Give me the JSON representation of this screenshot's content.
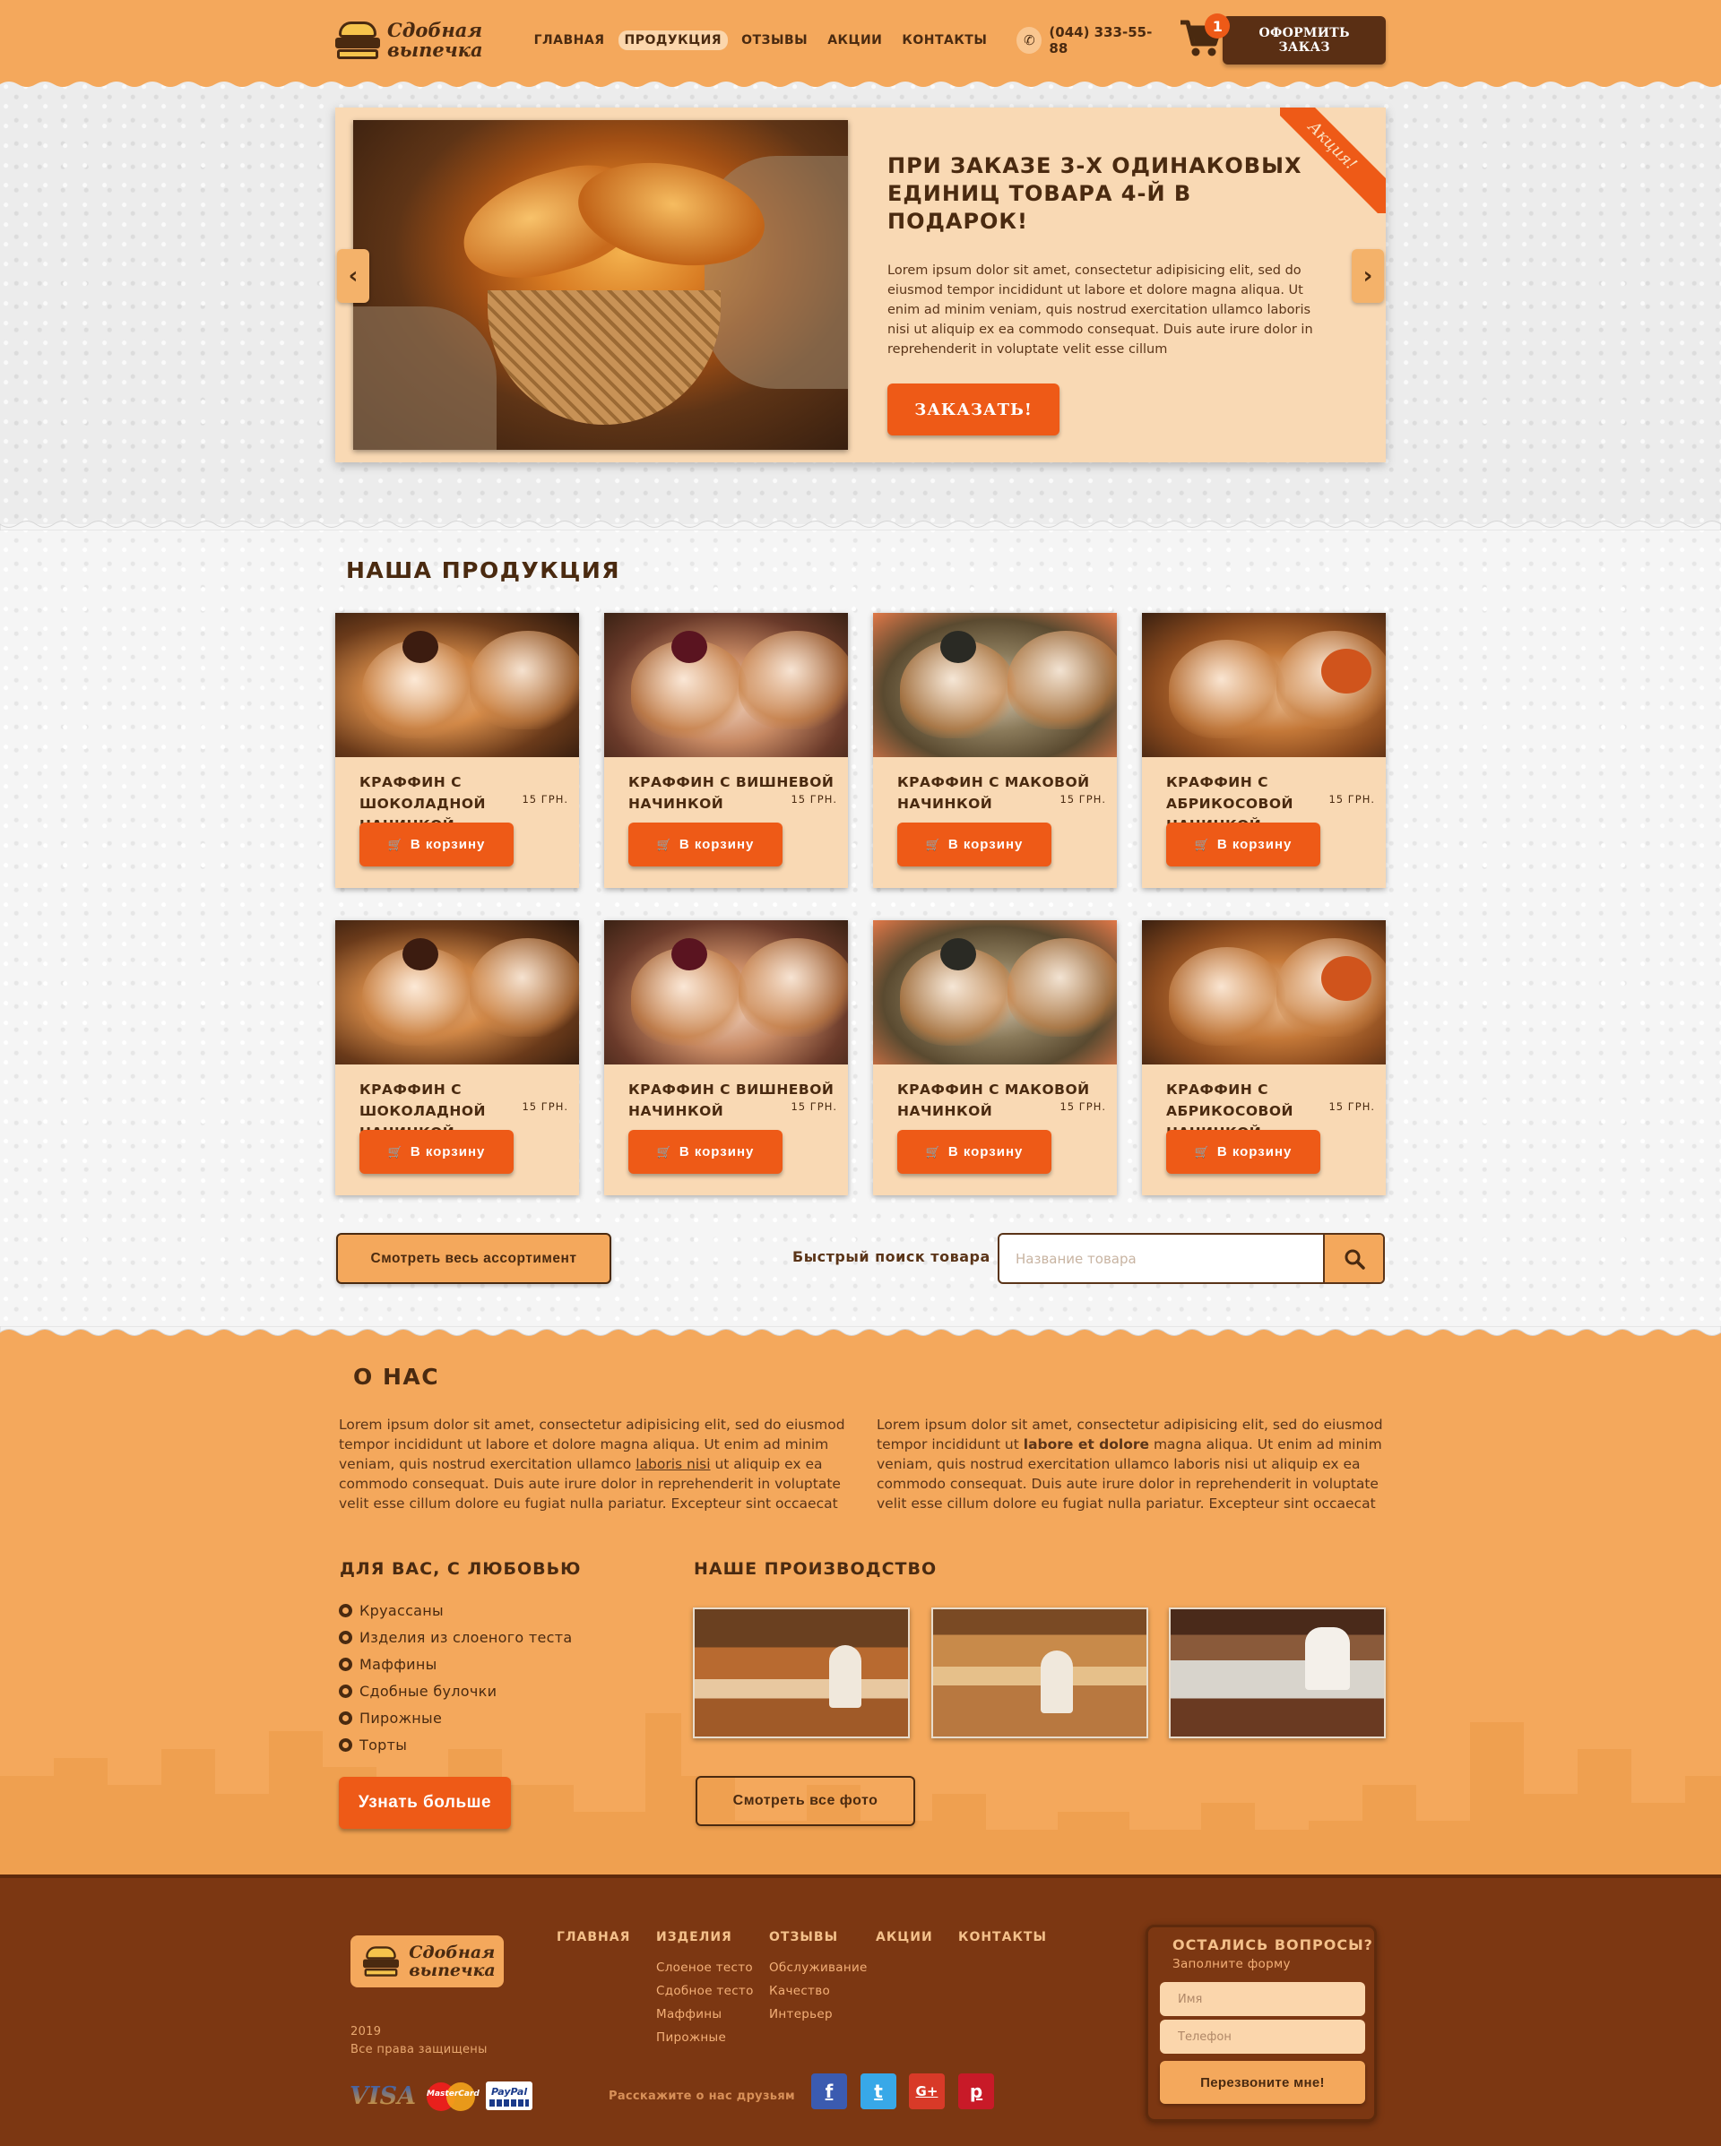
{
  "brand": {
    "line1": "Сдобная",
    "line2": "выпечка"
  },
  "nav": {
    "items": [
      {
        "label": "ГЛАВНАЯ"
      },
      {
        "label": "ПРОДУКЦИЯ",
        "active": true
      },
      {
        "label": "ОТЗЫВЫ"
      },
      {
        "label": "АКЦИИ"
      },
      {
        "label": "КОНТАКТЫ"
      }
    ]
  },
  "header": {
    "phone": "(044) 333-55-88",
    "cart_count": "1",
    "order_button": "ОФОРМИТЬ ЗАКАЗ"
  },
  "hero": {
    "title_line1": "ПРИ ЗАКАЗЕ 3-Х ОДИНАКОВЫХ",
    "title_line2": "ЕДИНИЦ ТОВАРА 4-Й В ПОДАРОК!",
    "text": "Lorem ipsum dolor sit amet, consectetur adipisicing elit, sed do eiusmod tempor incididunt ut labore et dolore magna aliqua. Ut enim ad minim veniam, quis nostrud exercitation ullamco laboris nisi ut aliquip ex ea commodo consequat. Duis aute irure dolor in reprehenderit in voluptate velit esse cillum",
    "button": "ЗАКАЗАТЬ!",
    "ribbon": "Акция!",
    "slides": 3,
    "active_slide": 2
  },
  "products": {
    "title": "НАША ПРОДУКЦИЯ",
    "add_to_cart": "В корзину",
    "items": [
      {
        "name1": "КРАФФИН С ШОКОЛАДНОЙ",
        "name2": "НАЧИНКОЙ",
        "price": "15 ГРН."
      },
      {
        "name1": "КРАФФИН С ВИШНЕВОЙ",
        "name2": "НАЧИНКОЙ",
        "price": "15 ГРН."
      },
      {
        "name1": "КРАФФИН С МАКОВОЙ",
        "name2": "НАЧИНКОЙ",
        "price": "15 ГРН."
      },
      {
        "name1": "КРАФФИН С АБРИКОСОВОЙ",
        "name2": "НАЧИНКОЙ",
        "price": "15 ГРН."
      },
      {
        "name1": "КРАФФИН С ШОКОЛАДНОЙ",
        "name2": "НАЧИНКОЙ",
        "price": "15 ГРН."
      },
      {
        "name1": "КРАФФИН С ВИШНЕВОЙ",
        "name2": "НАЧИНКОЙ",
        "price": "15 ГРН."
      },
      {
        "name1": "КРАФФИН С МАКОВОЙ",
        "name2": "НАЧИНКОЙ",
        "price": "15 ГРН."
      },
      {
        "name1": "КРАФФИН С АБРИКОСОВОЙ",
        "name2": "НАЧИНКОЙ",
        "price": "15 ГРН."
      }
    ],
    "all_button": "Смотреть весь ассортимент",
    "search_label": "Быстрый поиск товара",
    "search_placeholder": "Название товара"
  },
  "about": {
    "title": "О НАС",
    "col1_a": "Lorem ipsum dolor sit amet, consectetur adipisicing elit, sed do eiusmod tempor incididunt ut labore et dolore magna aliqua. Ut enim ad minim veniam, quis nostrud exercitation ullamco ",
    "col1_link": "laboris nisi",
    "col1_b": " ut aliquip ex ea commodo consequat. Duis aute irure dolor in reprehenderit in voluptate velit esse cillum dolore eu fugiat nulla pariatur. Excepteur sint occaecat",
    "col2_a": "Lorem ipsum dolor sit amet, consectetur adipisicing elit, sed do eiusmod tempor incididunt ut ",
    "col2_bold": "labore et dolore",
    "col2_b": " magna aliqua. Ut enim ad minim veniam, quis nostrud exercitation ullamco laboris nisi ut aliquip ex ea commodo consequat. Duis aute irure dolor in reprehenderit in voluptate velit esse cillum dolore eu fugiat nulla pariatur. Excepteur sint occaecat",
    "love_title": "ДЛЯ ВАС, С ЛЮБОВЬЮ",
    "love_items": [
      "Круассаны",
      "Изделия из слоеного теста",
      "Маффины",
      "Сдобные булочки",
      "Пирожные",
      "Торты"
    ],
    "more_button": "Узнать больше",
    "production_title": "НАШЕ ПРОИЗВОДСТВО",
    "photos_button": "Смотреть все фото"
  },
  "footer": {
    "year": "2019",
    "rights": "Все права защищены",
    "nav": {
      "home": "ГЛАВНАЯ",
      "products": "ИЗДЕЛИЯ",
      "products_items": [
        "Слоеное тесто",
        "Сдобное тесто",
        "Маффины",
        "Пирожные"
      ],
      "reviews": "ОТЗЫВЫ",
      "reviews_items": [
        "Обслуживание",
        "Качество",
        "Интерьер"
      ],
      "promos": "АКЦИИ",
      "contacts": "КОНТАКТЫ"
    },
    "share": "Расскажите о нас друзьям",
    "payments": {
      "visa": "VISA",
      "mastercard": "MasterCard",
      "paypal": "PayPal"
    },
    "social": {
      "facebook": "f",
      "twitter": "t",
      "googleplus": "G+",
      "pinterest": "p"
    },
    "form": {
      "title": "ОСТАЛИСЬ ВОПРОСЫ?",
      "subtitle": "Заполните форму",
      "name_placeholder": "Имя",
      "phone_placeholder": "Телефон",
      "button": "Перезвоните мне!"
    }
  },
  "colors": {
    "header_bg": "#f4a85c",
    "accent": "#ee5a17",
    "dark_brown": "#4a2a10",
    "card_bg": "#f9d9b4",
    "footer_bg": "#7c3712"
  }
}
